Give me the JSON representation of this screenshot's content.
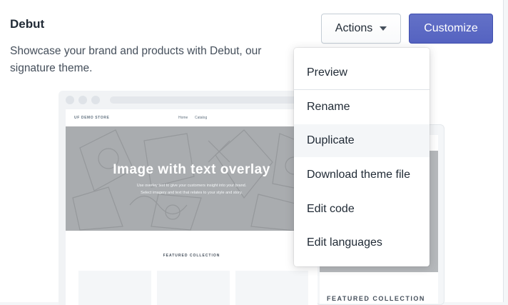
{
  "theme": {
    "title": "Debut",
    "description": "Showcase your brand and products with Debut, our signature theme."
  },
  "header_buttons": {
    "actions_label": "Actions",
    "customize_label": "Customize"
  },
  "actions_menu": {
    "items": [
      {
        "label": "Preview"
      },
      {
        "label": "Rename"
      },
      {
        "label": "Duplicate",
        "highlighted": true
      },
      {
        "label": "Download theme file"
      },
      {
        "label": "Edit code"
      },
      {
        "label": "Edit languages"
      }
    ]
  },
  "preview": {
    "store_name": "UF DEMO STORE",
    "nav": [
      "Home",
      "Catalog"
    ],
    "hero_title": "Image with text overlay",
    "hero_line_1": "Use overlay text to give your customers insight into your brand.",
    "hero_line_2": "Select imagery and text that relates to your style and story.",
    "featured_label": "FEATURED COLLECTION",
    "back_featured_label": "FEATURED COLLECTION"
  },
  "colors": {
    "primary": "#5c6ac4",
    "text": "#212b36",
    "hero_gray": "#a9acaf"
  }
}
